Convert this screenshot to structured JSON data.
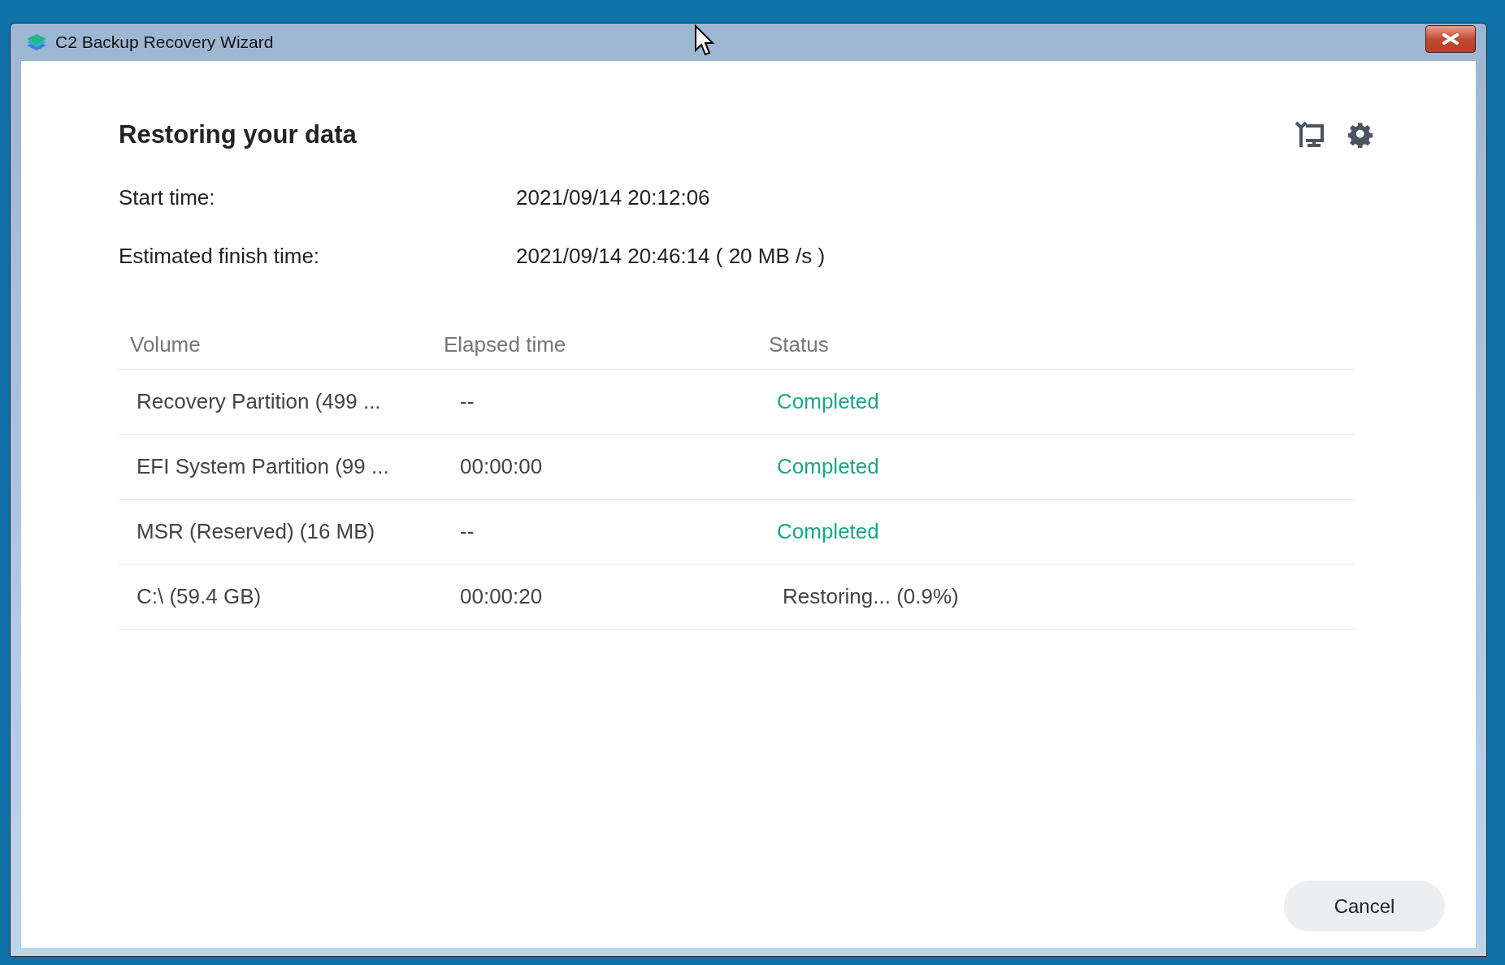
{
  "window": {
    "title": "C2 Backup Recovery Wizard"
  },
  "heading": "Restoring your data",
  "info": [
    {
      "label": "Start time:",
      "value": "2021/09/14 20:12:06"
    },
    {
      "label": "Estimated finish time:",
      "value": "2021/09/14 20:46:14 ( 20 MB /s )"
    }
  ],
  "table": {
    "columns": [
      "Volume",
      "Elapsed time",
      "Status"
    ],
    "rows": [
      {
        "volume": "Recovery Partition (499 ...",
        "elapsed": "--",
        "status": "Completed",
        "kind": "completed"
      },
      {
        "volume": "EFI System Partition (99 ...",
        "elapsed": "00:00:00",
        "status": "Completed",
        "kind": "completed"
      },
      {
        "volume": "MSR (Reserved) (16 MB)",
        "elapsed": "--",
        "status": "Completed",
        "kind": "completed"
      },
      {
        "volume": "C:\\ (59.4 GB)",
        "elapsed": "00:00:20",
        "status": "Restoring... (0.9%)",
        "kind": "progress"
      }
    ]
  },
  "buttons": {
    "cancel": "Cancel"
  }
}
